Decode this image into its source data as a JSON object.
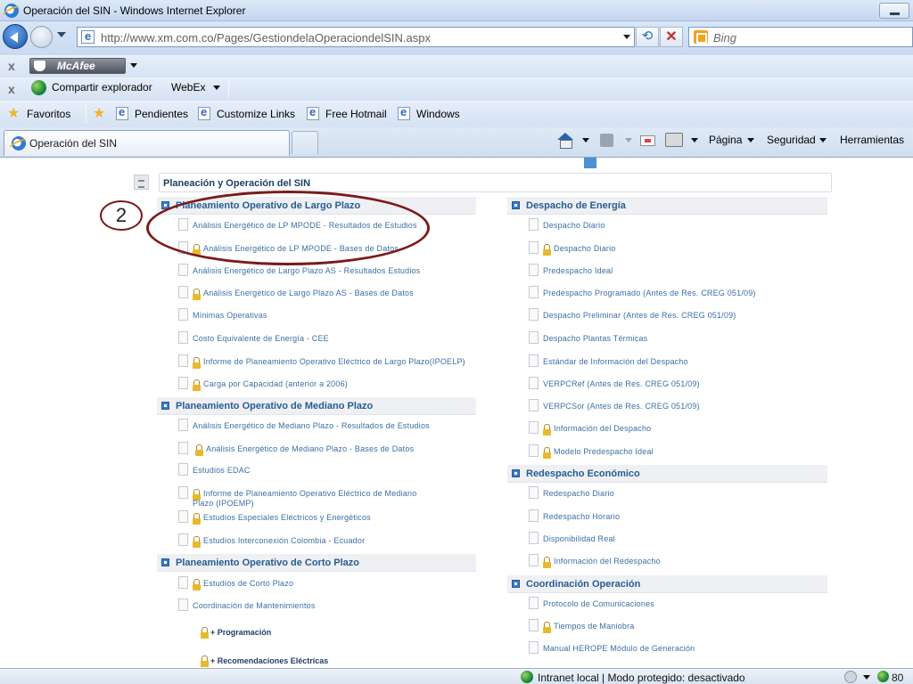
{
  "window": {
    "title": "Operación del SIN - Windows Internet Explorer"
  },
  "address": {
    "url": "http://www.xm.com.co/Pages/GestiondelaOperaciondelSIN.aspx"
  },
  "search": {
    "placeholder": "Bing"
  },
  "toolbar1": {
    "brand": "McAfee"
  },
  "toolbar2": {
    "share": "Compartir explorador",
    "webex": "WebEx"
  },
  "favorites": {
    "label": "Favoritos",
    "items": [
      "Pendientes",
      "Customize Links",
      "Free Hotmail",
      "Windows"
    ]
  },
  "tab": {
    "title": "Operación del SIN"
  },
  "commands": {
    "page": "Página",
    "safety": "Seguridad",
    "tools": "Herramientas"
  },
  "page": {
    "banner": "Planeación y Operación del SIN",
    "annotation": "2",
    "left": {
      "largo": {
        "title": "Planeamiento Operativo de Largo Plazo",
        "items": [
          "Análisis Energético de LP MPODE - Resultados de Estudios",
          "Análisis Energético de LP MPODE - Bases de Datos",
          "Análisis Energético de Largo Plazo AS - Resultados Estudios",
          "Análisis Energético de Largo Plazo AS - Bases de Datos",
          "Mínimas Operativas",
          "Costo Equivalente de Energía - CEE",
          "Informe de Planeamiento Operativo Eléctrico de Largo Plazo(IPOELP)",
          "Carga por Capacidad (anterior a 2006)"
        ]
      },
      "mediano": {
        "title": "Planeamiento Operativo de Mediano Plazo",
        "items": [
          "Análisis Energético de Mediano Plazo - Resultados de Estudios",
          "Análisis Energético de Mediano Plazo - Bases de Datos",
          "Estudios EDAC",
          "Informe de Planeamiento Operativo Eléctrico de Mediano",
          "Plazo (IPOEMP)",
          "Estudios Especiales Eléctricos y Energéticos",
          "Estudios Interconexión Colombia - Ecuador"
        ]
      },
      "corto": {
        "title": "Planeamiento Operativo de Corto Plazo",
        "items": [
          "Estudios de Corto Plazo",
          "Coordinación de Mantenimientos"
        ],
        "subs": [
          "+ Programación",
          "+ Recomendaciones Eléctricas"
        ]
      }
    },
    "right": {
      "despacho": {
        "title": "Despacho de Energía",
        "items": [
          "Despacho Diario",
          "Despacho Diario",
          "Predespacho Ideal",
          "Predespacho Programado (Antes de Res. CREG 051/09)",
          "Despacho Preliminar (Antes de Res. CREG 051/09)",
          "Despacho Plantas Térmicas",
          "Estándar de Información del Despacho",
          "VERPCRef (Antes de Res. CREG 051/09)",
          "VERPCSor (Antes de Res. CREG 051/09)",
          "Información del Despacho",
          "Modelo Predespacho Ideal"
        ]
      },
      "redespacho": {
        "title": "Redespacho Económico",
        "items": [
          "Redespacho Diario",
          "Redespacho Horario",
          "Disponibilidad Real",
          "Información del Redespacho"
        ]
      },
      "coordinacion": {
        "title": "Coordinación Operación",
        "items": [
          "Protocolo de Comunicaciones",
          "Tiempos de Maniobra",
          "Manual HEROPE Módulo de Generación"
        ]
      }
    }
  },
  "status": {
    "zone": "Intranet local | Modo protegido: desactivado",
    "zoom": "80"
  }
}
